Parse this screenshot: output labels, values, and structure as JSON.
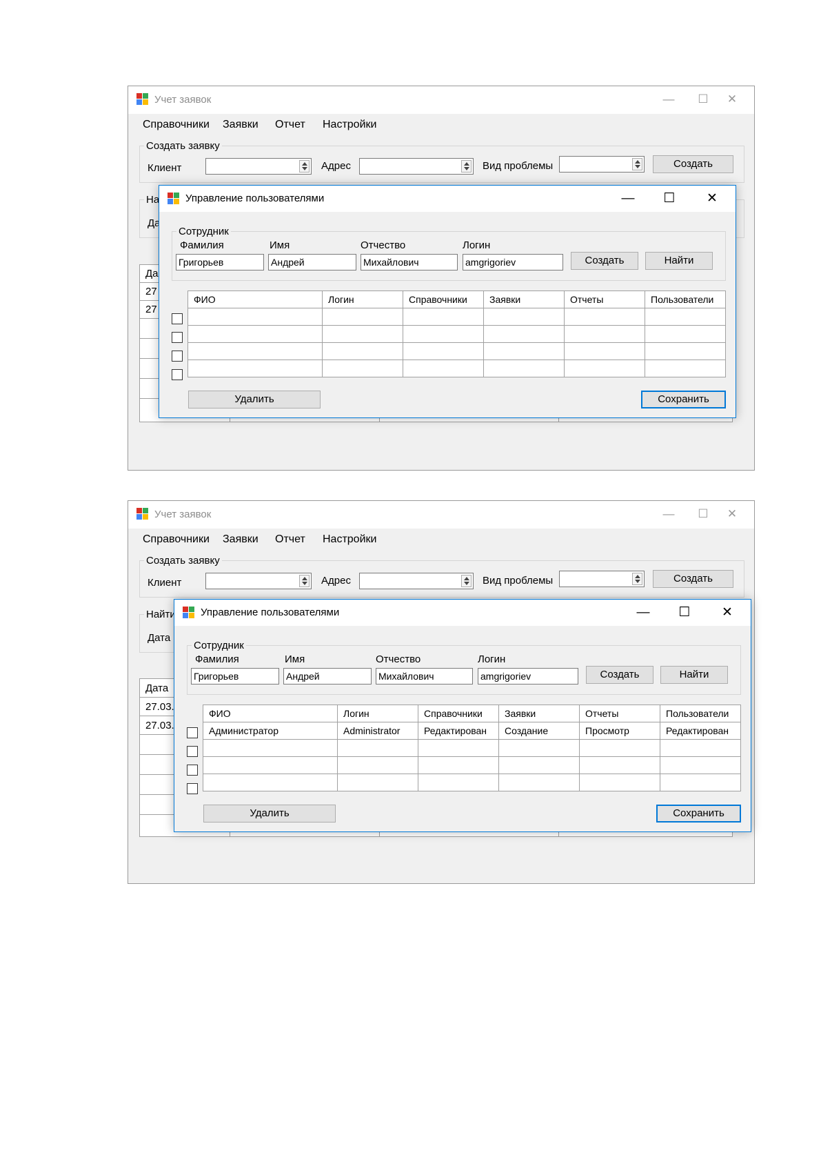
{
  "colors": {
    "accent": "#0078d7",
    "window_bg": "#f0f0f0",
    "border": "#9a9a9a"
  },
  "main_window": {
    "title": "Учет заявок",
    "controls": {
      "minimize": "—",
      "maximize": "☐",
      "close": "✕"
    },
    "menu": [
      "Справочники",
      "Заявки",
      "Отчет",
      "Настройки"
    ],
    "create_group": {
      "legend": "Создать заявку",
      "client_label": "Клиент",
      "address_label": "Адрес",
      "problem_label": "Вид проблемы",
      "create_button": "Создать"
    },
    "find_group_legend_s1": "На",
    "find_group_legend_s2": "Найти",
    "date_label_s1": "Да",
    "date_label_s2": "Дата",
    "grid": {
      "header_s1": "Да",
      "header_s2": "Дата",
      "rows_s1": [
        "27",
        "27"
      ],
      "rows_s2": [
        "27.03.",
        "27.03."
      ]
    }
  },
  "user_dialog": {
    "title": "Управление пользователями",
    "controls": {
      "minimize": "—",
      "maximize": "☐",
      "close": "✕"
    },
    "employee_group": {
      "legend": "Сотрудник",
      "lastname_label": "Фамилия",
      "firstname_label": "Имя",
      "patronymic_label": "Отчество",
      "login_label": "Логин",
      "lastname_value": "Григорьев",
      "firstname_value": "Андрей",
      "patronymic_value": "Михайлович",
      "login_value": "amgrigoriev",
      "create_button": "Создать",
      "find_button": "Найти"
    },
    "columns": [
      "ФИО",
      "Логин",
      "Справочники",
      "Заявки",
      "Отчеты",
      "Пользователи"
    ],
    "rows_s2": [
      [
        "Администратор",
        "Administrator",
        "Редактирован",
        "Создание",
        "Просмотр",
        "Редактирован"
      ]
    ],
    "delete_button": "Удалить",
    "save_button": "Сохранить"
  }
}
